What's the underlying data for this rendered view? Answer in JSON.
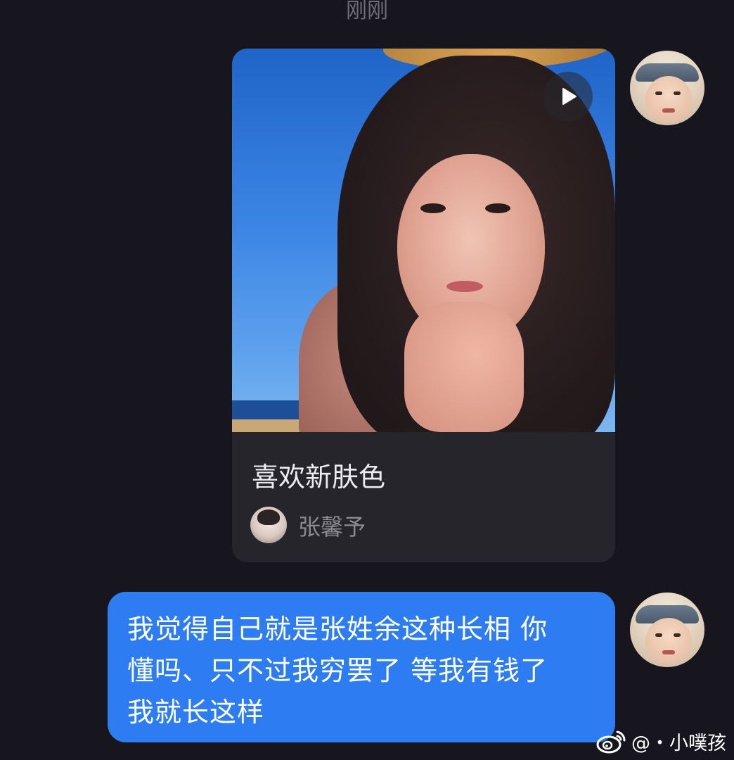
{
  "timestamp": "刚刚",
  "card": {
    "title": "喜欢新肤色",
    "author": "张馨予",
    "play_icon": "play-icon"
  },
  "message": {
    "text": "我觉得自己就是张姓余这种长相 你\n懂吗、只不过我穷罢了 等我有钱了\n我就长这样"
  },
  "watermark": {
    "text": "@・小噗孩",
    "icon": "weibo-logo-icon"
  },
  "colors": {
    "background": "#17161e",
    "bubble": "#2d7cf2",
    "card": "#26252b"
  }
}
